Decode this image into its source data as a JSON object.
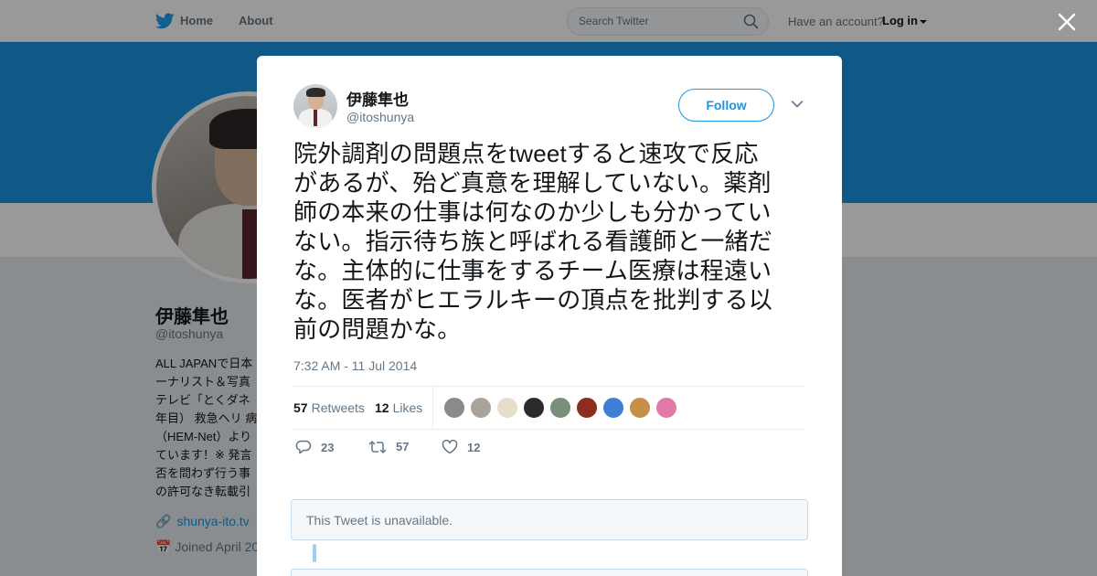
{
  "nav": {
    "home_label": "Home",
    "about_label": "About",
    "search_placeholder": "Search Twitter",
    "have_account": "Have an account?",
    "login_label": "Log in",
    "logo_icon": "twitter-bird-icon",
    "brand_color": "#1da1f2"
  },
  "profile": {
    "name": "伊藤隼也",
    "handle": "@itoshunya",
    "bio_lines": [
      "ALL JAPANで日本",
      "ーナリスト＆写真",
      "テレビ「とくダネ",
      "年目） 救急ヘリ 病",
      "（HEM-Net）より",
      "ています！※ 発言",
      "否を問わず行う事",
      "の許可なき転載引"
    ],
    "url": "shunya-ito.tv",
    "joined": "Joined April 20"
  },
  "tweet": {
    "author_name": "伊藤隼也",
    "author_handle": "@itoshunya",
    "follow_label": "Follow",
    "text_lines": [
      "院外調剤の問題点をtweetすると速攻で反応",
      "があるが、殆ど真意を理解していない。薬剤",
      "師の本来の仕事は何なのか少しも分かってい",
      "ない。指示待ち族と呼ばれる看護師と一緒だ",
      "な。主体的に仕事をするチーム医療は程遠い",
      "な。医者がヒエラルキーの頂点を批判する以",
      "前の問題かな。"
    ],
    "timestamp": "7:32 AM - 11 Jul 2014",
    "retweets_count": "57",
    "retweets_label": "Retweets",
    "likes_count": "12",
    "likes_label": "Likes",
    "likers": [
      {
        "color": "#8a8a8a"
      },
      {
        "color": "#a9a39c"
      },
      {
        "color": "#e8dccb"
      },
      {
        "color": "#2b2b2b"
      },
      {
        "color": "#7a8f7a"
      },
      {
        "color": "#8b2e1f"
      },
      {
        "color": "#3f7fd6"
      },
      {
        "color": "#c7904a"
      },
      {
        "color": "#e07aa8"
      }
    ],
    "actions": {
      "reply_count": "23",
      "retweet_count": "57",
      "like_count": "12"
    },
    "quoted_unavailable": "This Tweet is unavailable."
  }
}
